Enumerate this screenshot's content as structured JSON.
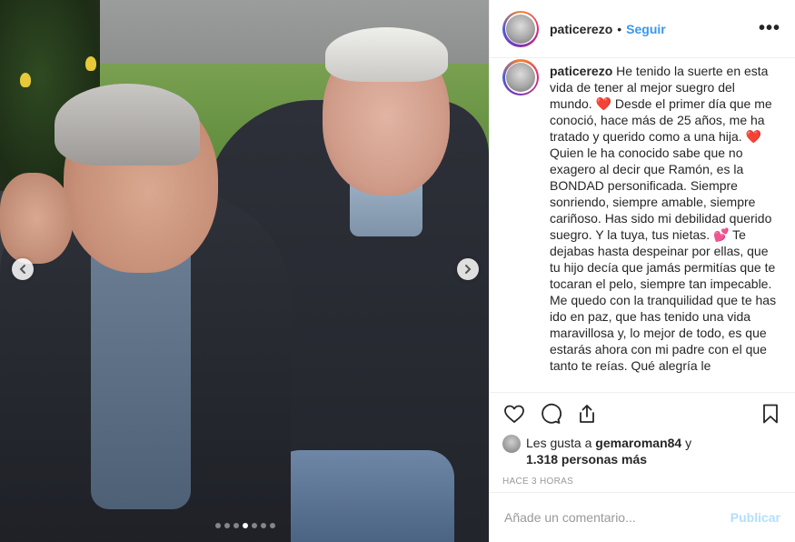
{
  "post": {
    "username": "paticerezo",
    "separator": "•",
    "follow_label": "Seguir",
    "more_label": "•••",
    "caption_username": "paticerezo",
    "caption_part1": "He tenido la suerte en esta vida de tener al mejor suegro del mundo.",
    "caption_emoji1": "❤️",
    "caption_part2": "Desde el primer día que me conoció, hace más de 25 años, me ha tratado y querido como a una hija.",
    "caption_emoji2": "❤️",
    "caption_part3": "Quien le ha conocido sabe que no exagero al decir que Ramón, es la BONDAD personificada. Siempre sonriendo, siempre amable, siempre cariñoso. Has sido mi debilidad querido suegro. Y la tuya, tus nietas.",
    "caption_emoji3": "💕",
    "caption_part4": "Te dejabas hasta despeinar por ellas, que tu hijo decía que jamás permitías que te tocaran el pelo, siempre tan impecable. Me quedo con la tranquilidad que te has ido en paz, que has tenido una vida maravillosa y, lo mejor de todo, es que estarás ahora con mi padre con el que tanto te reías. Qué alegría le",
    "likes_prefix": "Les gusta a",
    "likes_user": "gemaroman84",
    "likes_conj": "y",
    "likes_others": "1.318 personas más",
    "time_ago": "HACE 3 HORAS",
    "carousel_dots": 7,
    "carousel_active": 3
  },
  "comment": {
    "placeholder": "Añade un comentario...",
    "publish_label": "Publicar"
  },
  "icons": {
    "like": "heart-icon",
    "comment": "comment-icon",
    "share": "share-icon",
    "save": "bookmark-icon",
    "prev": "chevron-left-icon",
    "next": "chevron-right-icon"
  },
  "colors": {
    "link": "#3897f0",
    "publish_disabled": "#b2dffc",
    "text": "#262626",
    "muted": "#999999"
  }
}
